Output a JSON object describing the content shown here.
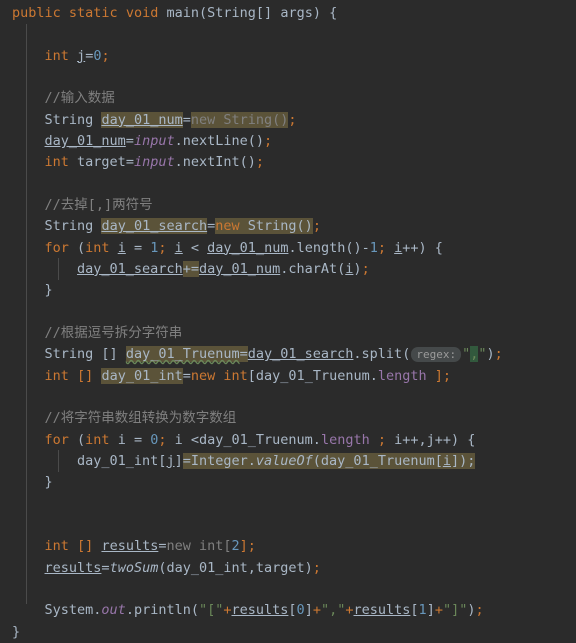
{
  "editor": {
    "theme": "darcula",
    "background": "#2b2b2b",
    "default_text_color": "#a9b7c6",
    "colors": {
      "keyword": "#cc7832",
      "string": "#6a8759",
      "number": "#6897bb",
      "comment": "#808080",
      "field": "#9876aa",
      "highlight": "#5b5339",
      "regex_group_highlight": "#32593d",
      "inlay_hint_background": "#45494a",
      "indent_guide": "#4b4b4b"
    }
  },
  "inlay_hints": {
    "regex": "regex:"
  },
  "code": {
    "line_01": {
      "kw_public": "public",
      "kw_static": "static",
      "kw_void": "void",
      "name_main": "main",
      "open_paren": "(",
      "type_string": "String[]",
      "arg_args": "args",
      "close_paren": ")",
      "brace": "{"
    },
    "line_03": {
      "kw_int": "int",
      "var_j": "j",
      "eq": "=",
      "num_0": "0",
      "semi": ";"
    },
    "line_05_comment": "//输入数据",
    "line_06": {
      "type_string": "String",
      "var": "day_01_num",
      "eq": "=",
      "kw_new": "new",
      "ctor": "String()",
      "semi": ";"
    },
    "line_07": {
      "var": "day_01_num",
      "eq": "=",
      "field_input": "input",
      "dot_call": ".nextLine()",
      "semi": ";"
    },
    "line_08": {
      "kw_int": "int",
      "var_target": "target",
      "eq": "=",
      "field_input": "input",
      "dot_call": ".nextInt()",
      "semi": ";"
    },
    "line_10_comment": "//去掉[,]两符号",
    "line_11": {
      "type_string": "String",
      "var": "day_01_search",
      "eq": "=",
      "kw_new": "new",
      "ctor": "String()",
      "semi": ";"
    },
    "line_12": {
      "kw_for": "for",
      "open": " (",
      "kw_int": "int",
      "var_i": "i",
      "init": " = ",
      "num_1": "1",
      "semi1": "; ",
      "cond_i": "i",
      "lt": " < ",
      "arr": "day_01_num",
      "len_call": ".length()-",
      "num_1b": "1",
      "semi2": "; ",
      "inc_i": "i",
      "incop": "++) ",
      "brace": "{"
    },
    "line_13": {
      "var_search": "day_01_search",
      "pluseq": "+=",
      "var_num": "day_01_num",
      "charat": ".charAt(",
      "arg_i": "i",
      "close": ")",
      "semi": ";"
    },
    "line_14_brace": "}",
    "line_16_comment": "//根据逗号拆分字符串",
    "line_17": {
      "type_string": "String []",
      "var_truenum": "day_01_Truenum",
      "eq": "=",
      "var_search": "day_01_search",
      "split": ".split(",
      "hint_regex": "regex:",
      "quote_open": "\"",
      "comma": ",",
      "quote_close": "\"",
      "close": ")",
      "semi": ";"
    },
    "line_18": {
      "kw_int": "int []",
      "var_int": "day_01_int",
      "eq": "=",
      "kw_new": "new",
      "type_int": "int",
      "bracket_open": "[",
      "arr": "day_01_Truenum.",
      "field_length": "length",
      "bracket_close": " ];"
    },
    "line_20_comment": "//将字符串数组转换为数字数组",
    "line_21": {
      "kw_for": "for",
      "open": " (",
      "kw_int": "int",
      "var_i": "i",
      "init": " = ",
      "num_0": "0",
      "semi1": "; ",
      "cond": "i <day_01_Truenum.",
      "field_length": "length",
      "semi2": " ; ",
      "incs": "i++,j++) ",
      "brace": "{"
    },
    "line_22": {
      "lhs": "day_01_int[",
      "idx_j": "j",
      "lhs_close": "]",
      "eq": "=",
      "integer": "Integer.",
      "valueof": "valueOf",
      "open": "(day_01_Truenum[",
      "idx_i": "i",
      "close": "]);"
    },
    "line_23_brace": "}",
    "line_25": {
      "kw_int": "int []",
      "var_results": "results",
      "eq": "=",
      "kw_new": "new",
      "type": "int[",
      "num_2": "2",
      "close": "];"
    },
    "line_26": {
      "var_results": "results",
      "eq": "=",
      "mth_twosum": "twoSum",
      "args": "(day_01_int,target)",
      "semi": ";"
    },
    "line_28": {
      "system": "System.",
      "out": "out",
      "println": ".println(",
      "str1": "\"[\"",
      "plus1": "+",
      "res1": "results",
      "idx1_open": "[",
      "num_0": "0",
      "idx1_close": "]",
      "plus2": "+",
      "str2": "\",\"",
      "plus3": "+",
      "res2": "results",
      "idx2_open": "[",
      "num_1": "1",
      "idx2_close": "]",
      "plus4": "+",
      "str3": "\"]\"",
      "close": ")",
      "semi": ";"
    },
    "line_29_brace": "}"
  }
}
